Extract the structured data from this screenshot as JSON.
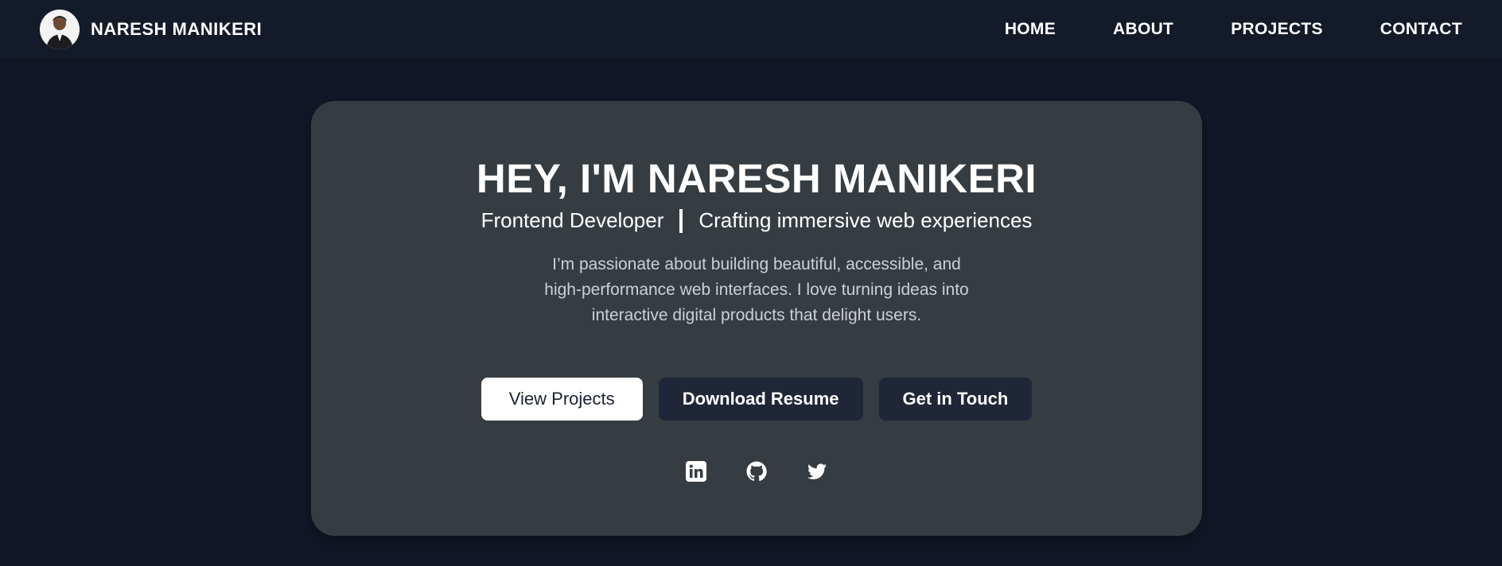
{
  "brand": {
    "name": "NARESH MANIKERI"
  },
  "nav": {
    "items": [
      {
        "label": "HOME"
      },
      {
        "label": "ABOUT"
      },
      {
        "label": "PROJECTS"
      },
      {
        "label": "CONTACT"
      }
    ]
  },
  "hero": {
    "title": "HEY, I'M NARESH MANIKERI",
    "role": "Frontend Developer",
    "tagline": "Crafting immersive web experiences",
    "description": "I’m passionate about building beautiful, accessible, and high-performance web interfaces. I love turning ideas into interactive digital products that delight users.",
    "buttons": {
      "view_projects": "View Projects",
      "download_resume": "Download Resume",
      "get_in_touch": "Get in Touch"
    },
    "socials": [
      {
        "icon": "linkedin-icon"
      },
      {
        "icon": "github-icon"
      },
      {
        "icon": "twitter-icon"
      }
    ]
  },
  "colors": {
    "background": "#121828",
    "navbar": "#131a29",
    "card": "#363d42",
    "button_dark": "#1f2637",
    "text": "#ffffff",
    "muted_text": "#cdd0d3"
  }
}
